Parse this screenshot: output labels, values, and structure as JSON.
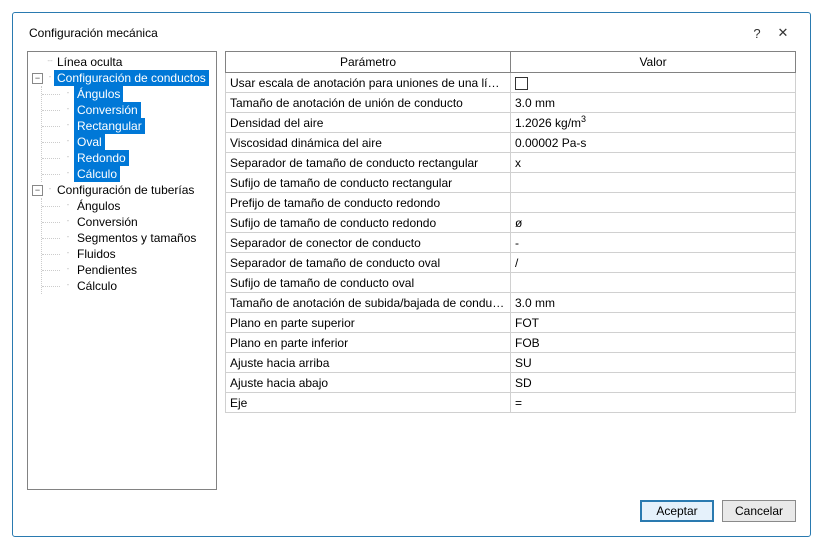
{
  "dialog": {
    "title": "Configuración mecánica",
    "help_icon": "?",
    "close_icon": "✕"
  },
  "tree": {
    "n1": "Línea oculta",
    "n2": "Configuración de conductos",
    "n2c": {
      "a": "Ángulos",
      "b": "Conversión",
      "c": "Rectangular",
      "d": "Oval",
      "e": "Redondo",
      "f": "Cálculo"
    },
    "n3": "Configuración de tuberías",
    "n3c": {
      "a": "Ángulos",
      "b": "Conversión",
      "c": "Segmentos y tamaños",
      "d": "Fluidos",
      "e": "Pendientes",
      "f": "Cálculo"
    }
  },
  "grid": {
    "h_param": "Parámetro",
    "h_value": "Valor",
    "rows": {
      "r0p": "Usar escala de anotación para uniones de una línea",
      "r1p": "Tamaño de anotación de unión de conducto",
      "r1v": "3.0 mm",
      "r2p": "Densidad del aire",
      "r2v_a": "1.2026 kg/m",
      "r2v_b": "3",
      "r3p": "Viscosidad dinámica del aire",
      "r3v": "0.00002 Pa-s",
      "r4p": "Separador de tamaño de conducto rectangular",
      "r4v": "x",
      "r5p": "Sufijo de tamaño de conducto rectangular",
      "r5v": "",
      "r6p": "Prefijo de tamaño de conducto redondo",
      "r6v": "",
      "r7p": "Sufijo de tamaño de conducto redondo",
      "r7v": "ø",
      "r8p": "Separador de conector de conducto",
      "r8v": "-",
      "r9p": "Separador de tamaño de conducto oval",
      "r9v": "/",
      "r10p": "Sufijo de tamaño de conducto oval",
      "r10v": "",
      "r11p": "Tamaño de anotación de subida/bajada de conducto",
      "r11v": "3.0 mm",
      "r12p": "Plano en parte superior",
      "r12v": "FOT",
      "r13p": "Plano en parte inferior",
      "r13v": "FOB",
      "r14p": "Ajuste hacia arriba",
      "r14v": "SU",
      "r15p": "Ajuste hacia abajo",
      "r15v": "SD",
      "r16p": "Eje",
      "r16v": "="
    }
  },
  "footer": {
    "ok": "Aceptar",
    "cancel": "Cancelar"
  }
}
